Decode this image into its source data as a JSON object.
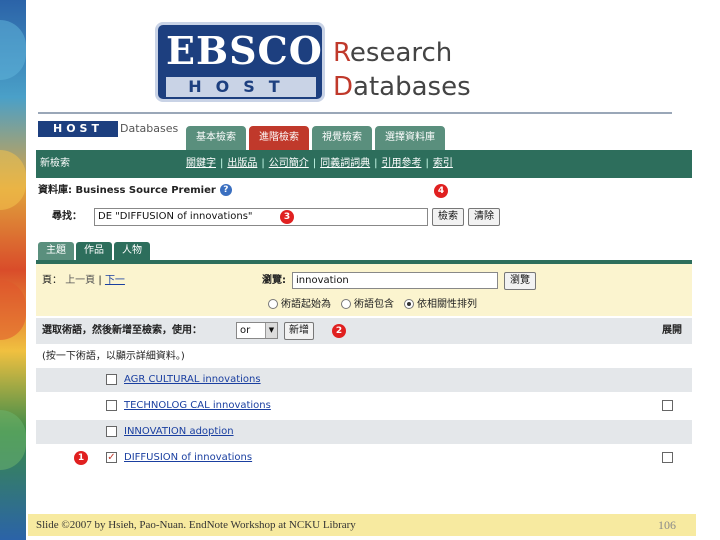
{
  "logo": {
    "top": "EBSCO",
    "bottom": "HOST",
    "right_line1_initial": "R",
    "right_line1_rest": "esearch",
    "right_line2_initial": "D",
    "right_line2_rest": "atabases"
  },
  "app": {
    "mini_logo": "HOST",
    "mini_db": "Databases",
    "tabs": [
      "基本檢索",
      "進階檢索",
      "視覺檢索",
      "選擇資料庫"
    ],
    "active_tab": "進階檢索"
  },
  "navbar": {
    "new_search": "新檢索",
    "links": [
      "關鍵字",
      "出版品",
      "公司簡介",
      "同義詞詞典",
      "引用參考",
      "索引"
    ]
  },
  "search": {
    "db_label": "資料庫: Business Source Premier",
    "find_label": "尋找：",
    "query_value": "DE \"DIFFUSION of innovations\"",
    "search_button": "檢索",
    "clear_button": "清除"
  },
  "subtabs": [
    "主題",
    "作品",
    "人物"
  ],
  "browse": {
    "page_label": "頁：",
    "prev": "上一頁",
    "sep": "|",
    "next": "下一",
    "browse_label": "瀏覽:",
    "browse_value": "innovation",
    "browse_button": "瀏覽",
    "radio_options": [
      "術語起始為",
      "術語包含",
      "依相關性排列"
    ]
  },
  "select_row": {
    "label": "選取術語，然後新增至檢索，使用：",
    "operator": "or",
    "add_button": "新增",
    "expand_label": "展開"
  },
  "hint": "(按一下術語，以顯示詳細資料。)",
  "terms": [
    {
      "label": "AGR CULTURAL innovations",
      "checked": false,
      "expand": false
    },
    {
      "label": "TECHNOLOG CAL innovations",
      "checked": false,
      "expand": true
    },
    {
      "label": "INNOVATION adoption",
      "checked": false,
      "expand": false
    },
    {
      "label": "DIFFUSION of innovations",
      "checked": true,
      "expand": true
    }
  ],
  "callouts": [
    "1",
    "2",
    "3",
    "4"
  ],
  "footer": {
    "text": "Slide ©2007 by Hsieh, Pao-Nuan. EndNote Workshop at NCKU Library",
    "page": "106"
  }
}
